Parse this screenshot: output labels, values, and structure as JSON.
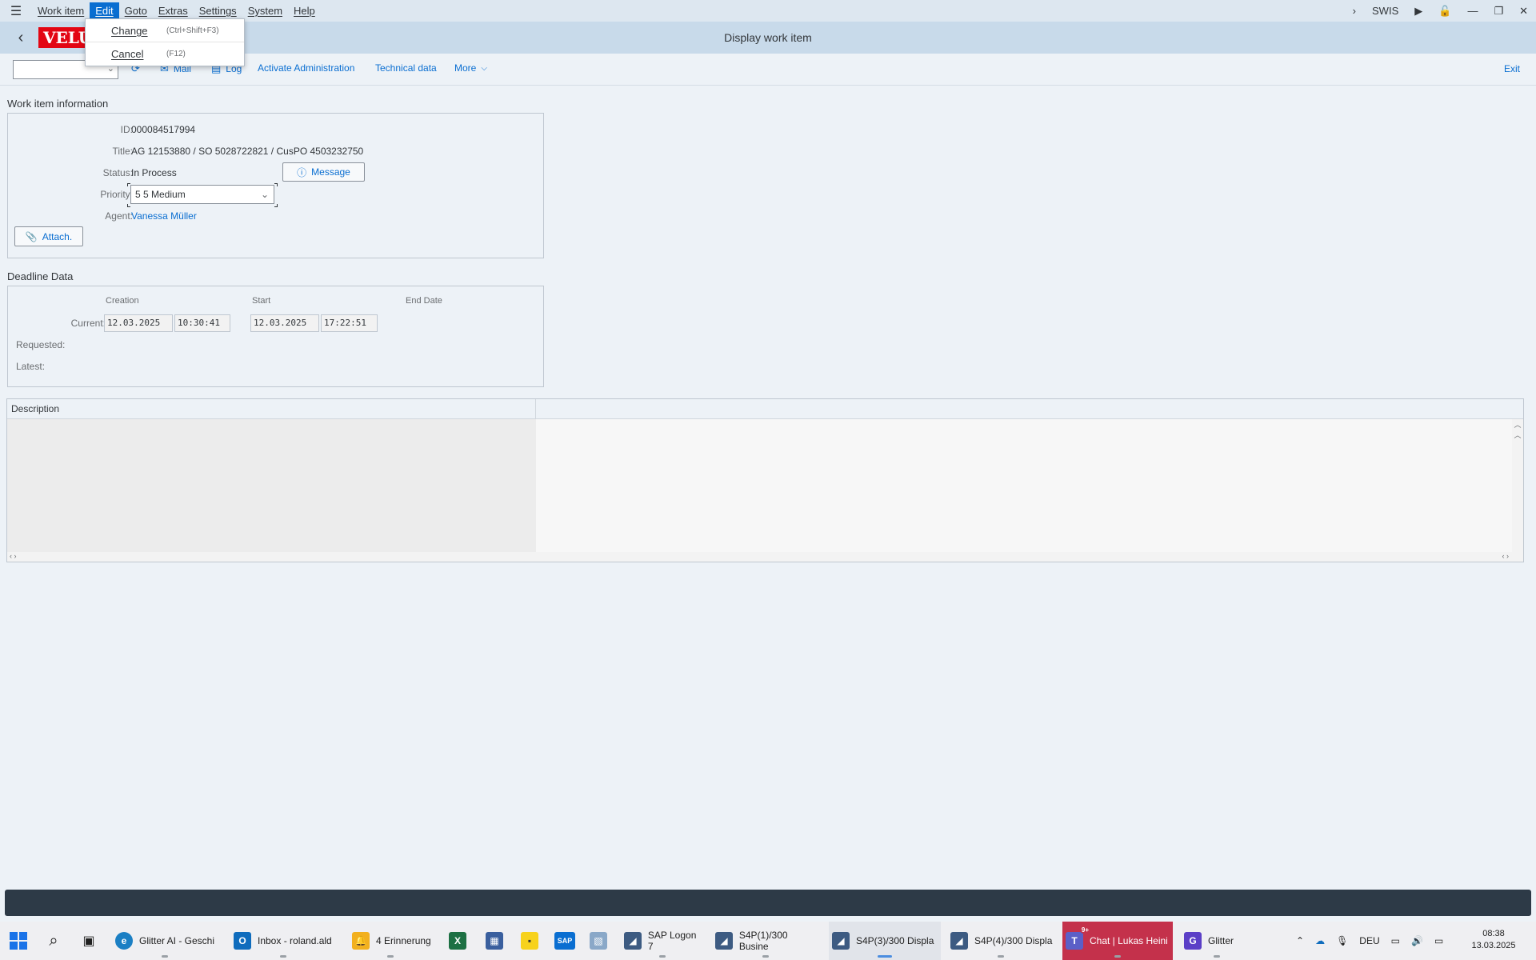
{
  "menubar": {
    "items": [
      "Work item",
      "Edit",
      "Goto",
      "Extras",
      "Settings",
      "System",
      "Help"
    ],
    "active": "Edit",
    "right_label": "SWIS"
  },
  "edit_menu": {
    "items": [
      {
        "label": "Change",
        "shortcut": "(Ctrl+Shift+F3)"
      },
      {
        "label": "Cancel",
        "shortcut": "(F12)"
      }
    ]
  },
  "titlebar": {
    "title": "Display work item",
    "logo_text": "VELUX"
  },
  "toolbar": {
    "command_field": "",
    "buttons": {
      "mail": "Mail",
      "log": "Log",
      "activate": "Activate Administration",
      "technical": "Technical data",
      "more": "More",
      "exit": "Exit"
    }
  },
  "work_item": {
    "section_title": "Work item information",
    "labels": {
      "id": "ID:",
      "title": "Title:",
      "status": "Status:",
      "priority": "Priority:",
      "agent": "Agent:"
    },
    "values": {
      "id": "000084517994",
      "title": "AG 12153880 / SO 5028722821 / CusPO 4503232750",
      "status": "In Process",
      "priority": "5 5 Medium",
      "agent": "Vanessa Müller"
    },
    "message_button": "Message",
    "attach_button": "Attach."
  },
  "deadline": {
    "section_title": "Deadline Data",
    "columns": [
      "Creation",
      "Start",
      "End Date"
    ],
    "rows": {
      "current": "Current:",
      "requested": "Requested:",
      "latest": "Latest:"
    },
    "current": {
      "creation_date": "12.03.2025",
      "creation_time": "10:30:41",
      "start_date": "12.03.2025",
      "start_time": "17:22:51"
    }
  },
  "description": {
    "header": "Description"
  },
  "taskbar": {
    "items": [
      {
        "label": "Glitter AI - Geschi",
        "icon": "edge-icon",
        "color": "#1b7fc4"
      },
      {
        "label": "Inbox - roland.ald",
        "icon": "outlook-icon",
        "color": "#0f6cbd"
      },
      {
        "label": "4 Erinnerung",
        "icon": "bell-icon",
        "color": "#f2b01e"
      },
      {
        "label": "",
        "icon": "excel-icon",
        "color": "#1d7044"
      },
      {
        "label": "",
        "icon": "calculator-icon",
        "color": "#3a5f9e"
      },
      {
        "label": "",
        "icon": "sticky-notes-icon",
        "color": "#f7d21c"
      },
      {
        "label": "",
        "icon": "sap-icon",
        "color": "#0a6ed1"
      },
      {
        "label": "",
        "icon": "image-icon",
        "color": "#8aa8c8"
      },
      {
        "label": "SAP Logon 7",
        "icon": "sap-logon-icon",
        "color": "#3d5b82"
      },
      {
        "label": "S4P(1)/300 Busine",
        "icon": "sap-gui-icon",
        "color": "#3d5b82"
      },
      {
        "label": "S4P(3)/300 Displa",
        "icon": "sap-gui-icon",
        "color": "#3d5b82"
      },
      {
        "label": "S4P(4)/300 Displa",
        "icon": "sap-gui-icon",
        "color": "#3d5b82"
      },
      {
        "label": "Chat | Lukas Heini",
        "icon": "teams-icon",
        "color": "#5b5fc7",
        "badge": "9+"
      },
      {
        "label": "Glitter",
        "icon": "glitter-icon",
        "color": "#5b3fc7"
      }
    ],
    "tray": {
      "language": "DEU",
      "time": "08:38",
      "date": "13.03.2025"
    }
  }
}
